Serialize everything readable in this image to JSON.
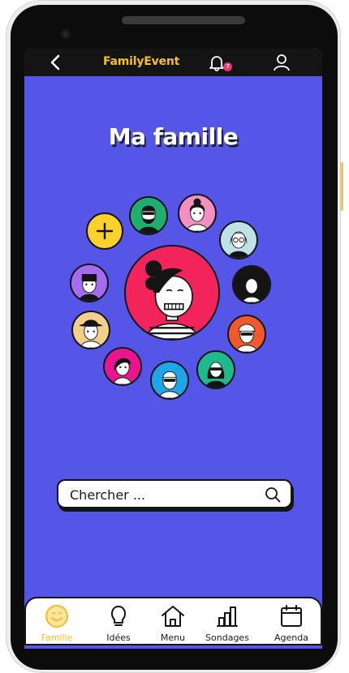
{
  "header": {
    "brand": "FamilyEvent",
    "notification_count": "7"
  },
  "page": {
    "title": "Ma famille"
  },
  "search": {
    "placeholder": "Chercher ..."
  },
  "family": {
    "add_label": "+",
    "members": [
      {
        "id": "center",
        "bg": "#f2245b"
      },
      {
        "id": "m1",
        "bg": "#1fae6e"
      },
      {
        "id": "m2",
        "bg": "#f48fbf"
      },
      {
        "id": "m3",
        "bg": "#bfe2e6"
      },
      {
        "id": "m4",
        "bg": "#141414"
      },
      {
        "id": "m5",
        "bg": "#f05a2a"
      },
      {
        "id": "m6",
        "bg": "#1fb98c"
      },
      {
        "id": "m7",
        "bg": "#1ea6e8"
      },
      {
        "id": "m8",
        "bg": "#e8158f"
      },
      {
        "id": "m9",
        "bg": "#f4cf8c"
      },
      {
        "id": "m10",
        "bg": "#a66cf0"
      }
    ]
  },
  "nav": {
    "items": [
      {
        "label": "Famille",
        "icon": "smile-icon",
        "active": true
      },
      {
        "label": "Idées",
        "icon": "lightbulb-icon",
        "active": false
      },
      {
        "label": "Menu",
        "icon": "home-icon",
        "active": false
      },
      {
        "label": "Sondages",
        "icon": "bar-chart-icon",
        "active": false
      },
      {
        "label": "Agenda",
        "icon": "calendar-icon",
        "active": false
      }
    ]
  },
  "colors": {
    "screen_bg": "#5556e8",
    "accent": "#f3bd28",
    "badge": "#f0346a"
  }
}
